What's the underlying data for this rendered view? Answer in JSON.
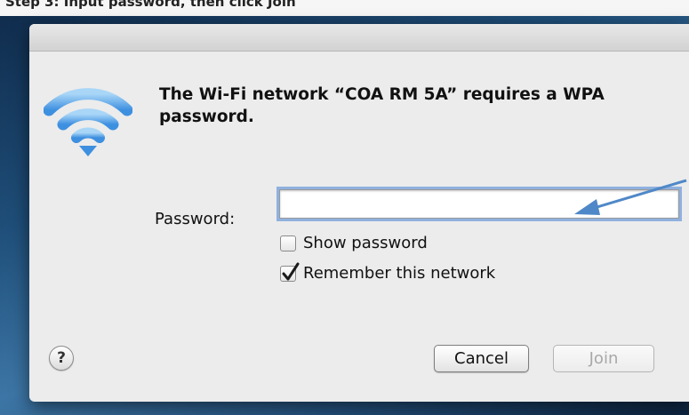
{
  "header_partial_text": "Step 3: Input password, then click Join",
  "dialog": {
    "message": "The Wi-Fi network “COA RM 5A” requires a WPA password.",
    "password_label": "Password:",
    "password_value": "",
    "show_password_label": "Show password",
    "show_password_checked": false,
    "remember_label": "Remember this network",
    "remember_checked": true,
    "help_label": "?",
    "cancel_label": "Cancel",
    "join_label": "Join",
    "join_enabled": false,
    "icon": "wifi-icon"
  },
  "annotation": {
    "icon": "arrow-icon",
    "color": "#4f88c8"
  }
}
